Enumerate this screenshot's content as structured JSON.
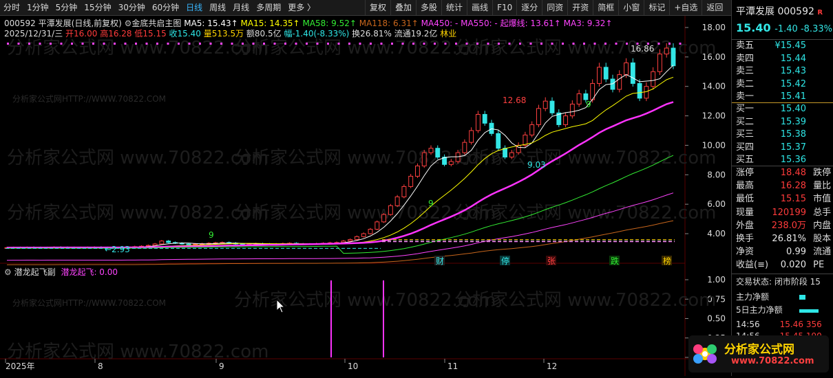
{
  "toolbar": {
    "periods": [
      "分时",
      "1分钟",
      "5分钟",
      "15分钟",
      "30分钟",
      "60分钟",
      "日线",
      "周线",
      "月线",
      "多周期",
      "更多 〉"
    ],
    "active_period": "日线",
    "tools": [
      "复权",
      "叠加",
      "多股",
      "统计",
      "画线",
      "F10",
      "逐分",
      "同资",
      "开资",
      "简框",
      "小窗",
      "标记",
      "+自选",
      "返回"
    ]
  },
  "header": {
    "code": "000592",
    "name": "平潭发展",
    "mode": "(日线,前复权)",
    "indicator": "金底共启主图",
    "ma": [
      {
        "label": "MA5: 15.43↑",
        "color": "#ffffff"
      },
      {
        "label": "MA15: 14.35↑",
        "color": "#ffff00"
      },
      {
        "label": "MA58: 9.52↑",
        "color": "#33ee33"
      },
      {
        "label": "MA118: 6.31↑",
        "color": "#c8661c"
      },
      {
        "label": "MA450: -",
        "color": "#ff44ff"
      },
      {
        "label": "MA550: -",
        "color": "#ff44ff"
      },
      {
        "label": "起爆线: 13.61↑",
        "color": "#ff44ff"
      },
      {
        "label": "MA3: 9.32↑",
        "color": "#ff44ff"
      }
    ],
    "line2": [
      {
        "text": "2025/12/31/三",
        "color": "#dddddd"
      },
      {
        "text": "开16.00",
        "color": "#ff3b3b"
      },
      {
        "text": "高16.28",
        "color": "#ff3b3b"
      },
      {
        "text": "低15.15",
        "color": "#ff3b3b"
      },
      {
        "text": "收15.40",
        "color": "#2ee6e6"
      },
      {
        "text": "量513.5万",
        "color": "#ffd400"
      },
      {
        "text": "额80.5亿",
        "color": "#dddddd"
      },
      {
        "text": "幅-1.40(-8.33%)",
        "color": "#2ee6e6"
      },
      {
        "text": "换26.81%",
        "color": "#dddddd"
      },
      {
        "text": "流通19.2亿",
        "color": "#dddddd"
      },
      {
        "text": "林业",
        "color": "#ffd400"
      }
    ]
  },
  "chart_data": [
    {
      "type": "candlestick",
      "y_ticks": [
        "18.00",
        "16.00",
        "14.00",
        "12.00",
        "10.00",
        "8.00",
        "6.00",
        "4.00"
      ],
      "ylim": [
        3.0,
        18.6
      ],
      "x_labels": [
        "2025年",
        "8",
        "9",
        "10",
        "11",
        "12"
      ],
      "annotations": [
        "16.86",
        "12.68",
        "9.03",
        "2.93",
        "财",
        "停",
        "张",
        "跌",
        "榜",
        "9"
      ],
      "closes": [
        3.05,
        3.06,
        3.05,
        3.07,
        3.06,
        3.05,
        3.06,
        3.08,
        3.07,
        3.06,
        3.05,
        3.06,
        3.07,
        3.08,
        3.06,
        3.05,
        3.07,
        3.08,
        3.1,
        3.12,
        3.15,
        3.2,
        3.3,
        3.5,
        3.4,
        3.35,
        3.3,
        3.28,
        3.3,
        3.32,
        3.35,
        3.38,
        3.4,
        3.36,
        3.3,
        3.28,
        3.3,
        3.32,
        3.3,
        3.28,
        3.3,
        3.33,
        3.35,
        3.3,
        3.28,
        3.3,
        3.32,
        3.35,
        3.38,
        3.4,
        3.5,
        3.6,
        3.8,
        4.0,
        4.3,
        4.8,
        5.3,
        5.9,
        6.5,
        7.2,
        7.9,
        8.6,
        9.5,
        9.8,
        9.2,
        8.7,
        8.9,
        9.5,
        10.2,
        11.0,
        12.1,
        11.5,
        10.8,
        9.8,
        9.2,
        9.5,
        10.0,
        10.7,
        11.4,
        12.5,
        13.0,
        12.2,
        11.4,
        12.0,
        12.8,
        13.5,
        13.1,
        14.2,
        15.3,
        14.5,
        13.8,
        14.8,
        15.6,
        14.2,
        13.2,
        14.0,
        15.0,
        16.2,
        16.6,
        15.4
      ],
      "ma_lines": [
        "MA5",
        "MA15",
        "MA58",
        "MA118",
        "起爆线"
      ]
    },
    {
      "type": "bar",
      "title": "潜龙起飞副",
      "value_label": "潜龙起飞: 0.00",
      "y_ticks": [
        "1.00",
        "0.75",
        "0.50",
        "0.25",
        "0.00"
      ],
      "ylim": [
        0,
        1.0
      ],
      "signals": [
        1,
        1
      ]
    }
  ],
  "subchart": {
    "title": "潜龙起飞副",
    "value": "潜龙起飞: 0.00"
  },
  "watermark": [
    "分析家公式网HTTP://WWW.70822.COM",
    "分析家公式网 www.70822.com"
  ],
  "side": {
    "name": "平潭发展",
    "code": "000592",
    "price": "15.40",
    "change": "-1.40",
    "pct": "-8.33%",
    "badge": "R",
    "asks": [
      [
        "卖五",
        "¥15.45"
      ],
      [
        "卖四",
        "15.44"
      ],
      [
        "卖三",
        "15.43"
      ],
      [
        "卖二",
        "15.42"
      ],
      [
        "卖一",
        "15.41"
      ]
    ],
    "bids": [
      [
        "买一",
        "15.40"
      ],
      [
        "买二",
        "15.39"
      ],
      [
        "买三",
        "15.38"
      ],
      [
        "买四",
        "15.37"
      ],
      [
        "买五",
        "15.36"
      ]
    ],
    "stats": [
      [
        "涨停",
        "18.48",
        "up",
        "跌停"
      ],
      [
        "最高",
        "16.28",
        "up",
        "量比"
      ],
      [
        "最低",
        "15.15",
        "up",
        "市值"
      ],
      [
        "现量",
        "120199",
        "up",
        "总手"
      ],
      [
        "外盘",
        "238.0万",
        "up",
        "内盘"
      ],
      [
        "换手",
        "26.81%",
        "wh",
        "股本"
      ],
      [
        "净资",
        "0.99",
        "wh",
        "流通"
      ],
      [
        "收益(≡)",
        "0.020",
        "wh",
        "PE"
      ]
    ],
    "trade_state": "交易状态: 闭市阶段 15",
    "flows": [
      {
        "label": "主力净额",
        "color": "#2ee6e6"
      },
      {
        "label": "5日主力净额",
        "color": "#2ee6e6"
      }
    ],
    "ticks": [
      {
        "time": "14:56",
        "price": "15.46",
        "vol": "356"
      },
      {
        "time": "14:56",
        "price": "15.45",
        "vol": "190"
      }
    ]
  },
  "logo": {
    "title": "分析家公式网",
    "url": "www.70822.com"
  }
}
